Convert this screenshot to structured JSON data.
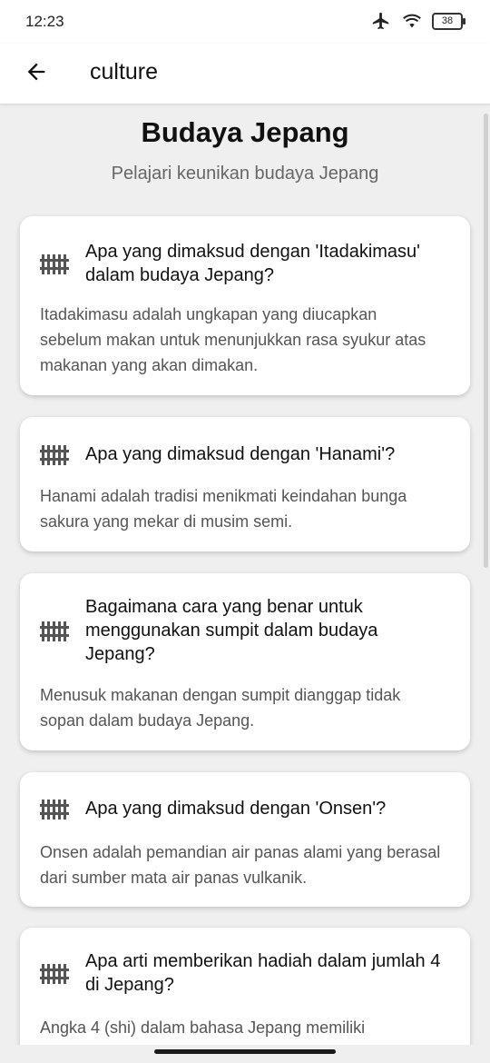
{
  "status_bar": {
    "time": "12:23",
    "battery": "38",
    "icons": [
      "airplane-icon",
      "wifi-icon",
      "battery-icon"
    ]
  },
  "app_bar": {
    "title": "culture",
    "back_icon": "arrow-left-icon"
  },
  "header": {
    "title": "Budaya Jepang",
    "subtitle": "Pelajari keunikan budaya Jepang"
  },
  "cards": [
    {
      "question": "Apa yang dimaksud dengan 'Itadakimasu' dalam budaya Jepang?",
      "answer": "Itadakimasu adalah ungkapan yang diucapkan sebelum makan untuk menunjukkan rasa syukur atas makanan yang akan dimakan.",
      "icon": "fence-icon"
    },
    {
      "question": "Apa yang dimaksud dengan 'Hanami'?",
      "answer": "Hanami adalah tradisi menikmati keindahan bunga sakura yang mekar di musim semi.",
      "icon": "fence-icon"
    },
    {
      "question": "Bagaimana cara yang benar untuk menggunakan sumpit dalam budaya Jepang?",
      "answer": "Menusuk makanan dengan sumpit dianggap tidak sopan dalam budaya Jepang.",
      "icon": "fence-icon"
    },
    {
      "question": "Apa yang dimaksud dengan 'Onsen'?",
      "answer": "Onsen adalah pemandian air panas alami yang berasal dari sumber mata air panas vulkanik.",
      "icon": "fence-icon"
    },
    {
      "question": "Apa arti memberikan hadiah dalam jumlah 4 di Jepang?",
      "answer": "Angka 4 (shi) dalam bahasa Jepang memiliki",
      "icon": "fence-icon"
    }
  ]
}
